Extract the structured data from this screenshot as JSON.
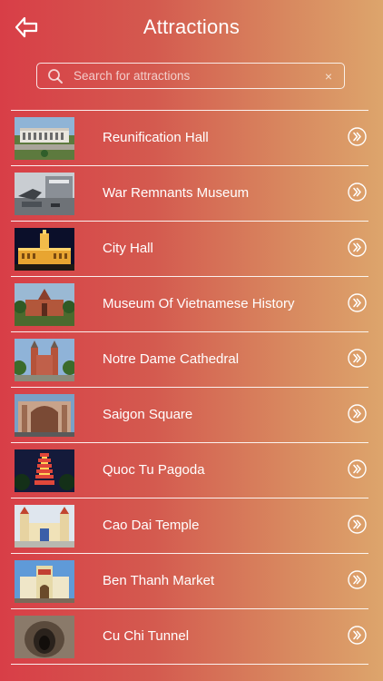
{
  "header": {
    "title": "Attractions"
  },
  "search": {
    "placeholder": "Search for attractions",
    "value": ""
  },
  "items": [
    {
      "label": "Reunification Hall",
      "thumb": "reunification"
    },
    {
      "label": "War Remnants Museum",
      "thumb": "war-museum"
    },
    {
      "label": "City Hall",
      "thumb": "city-hall"
    },
    {
      "label": "Museum Of Vietnamese History",
      "thumb": "history-museum"
    },
    {
      "label": "Notre Dame Cathedral",
      "thumb": "cathedral"
    },
    {
      "label": "Saigon Square",
      "thumb": "saigon-square"
    },
    {
      "label": "Quoc Tu Pagoda",
      "thumb": "pagoda"
    },
    {
      "label": "Cao Dai Temple",
      "thumb": "cao-dai"
    },
    {
      "label": "Ben Thanh Market",
      "thumb": "market"
    },
    {
      "label": "Cu Chi Tunnel",
      "thumb": "tunnel"
    }
  ]
}
